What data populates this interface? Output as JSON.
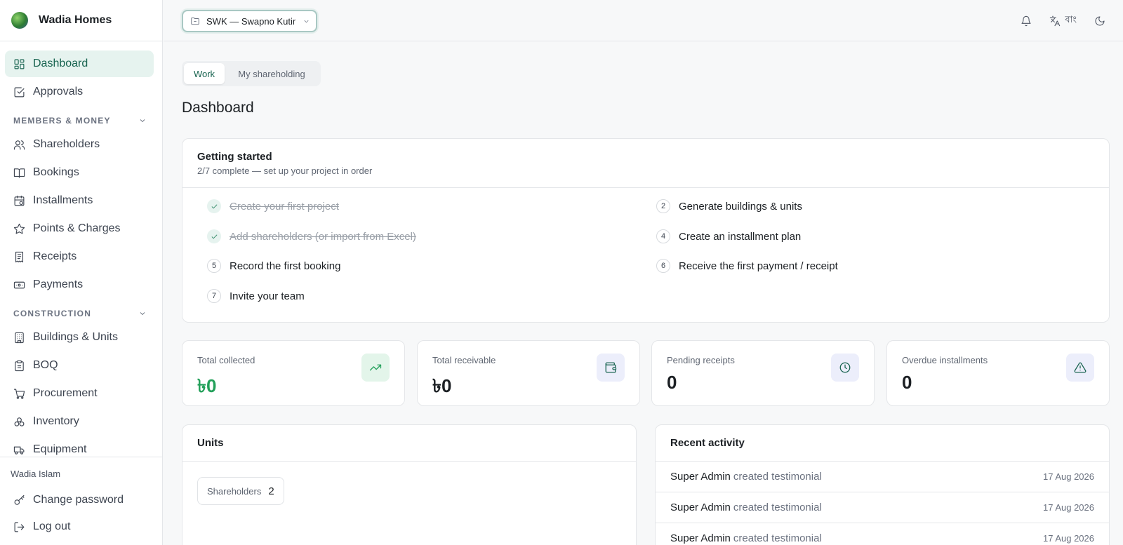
{
  "brand": {
    "name": "Wadia Homes"
  },
  "sidebar": {
    "top_items": [
      {
        "label": "Dashboard",
        "icon": "dashboard-icon",
        "active": true
      },
      {
        "label": "Approvals",
        "icon": "check-square-icon"
      }
    ],
    "sections": [
      {
        "label": "MEMBERS & MONEY",
        "items": [
          {
            "label": "Shareholders",
            "icon": "users-icon"
          },
          {
            "label": "Bookings",
            "icon": "book-icon"
          },
          {
            "label": "Installments",
            "icon": "calendar-clock-icon"
          },
          {
            "label": "Points & Charges",
            "icon": "star-icon"
          },
          {
            "label": "Receipts",
            "icon": "receipt-icon"
          },
          {
            "label": "Payments",
            "icon": "banknote-icon"
          }
        ]
      },
      {
        "label": "CONSTRUCTION",
        "items": [
          {
            "label": "Buildings & Units",
            "icon": "building-icon"
          },
          {
            "label": "BOQ",
            "icon": "clipboard-icon"
          },
          {
            "label": "Procurement",
            "icon": "cart-icon"
          },
          {
            "label": "Inventory",
            "icon": "boxes-icon"
          },
          {
            "label": "Equipment",
            "icon": "truck-icon"
          }
        ]
      }
    ],
    "footer": {
      "user": "Wadia Islam",
      "change_password": "Change password",
      "logout": "Log out"
    }
  },
  "topbar": {
    "project": "SWK — Swapno Kutir",
    "language": "বাং"
  },
  "tabs": [
    "Work",
    "My shareholding"
  ],
  "page_title": "Dashboard",
  "getting_started": {
    "title": "Getting started",
    "subtitle": "2/7 complete — set up your project in order",
    "steps": [
      {
        "num": "",
        "label": "Create your first project",
        "done": true
      },
      {
        "num": "2",
        "label": "Generate buildings & units",
        "done": false
      },
      {
        "num": "",
        "label": "Add shareholders (or import from Excel)",
        "done": true
      },
      {
        "num": "4",
        "label": "Create an installment plan",
        "done": false
      },
      {
        "num": "5",
        "label": "Record the first booking",
        "done": false
      },
      {
        "num": "6",
        "label": "Receive the first payment / receipt",
        "done": false
      },
      {
        "num": "7",
        "label": "Invite your team",
        "done": false
      }
    ]
  },
  "stats": [
    {
      "label": "Total collected",
      "value": "৳0",
      "icon": "trending-up-icon",
      "accent": "#23a05a"
    },
    {
      "label": "Total receivable",
      "value": "৳0",
      "icon": "wallet-icon",
      "accent": "#17634f"
    },
    {
      "label": "Pending receipts",
      "value": "0",
      "icon": "clock-icon",
      "accent": "#17634f"
    },
    {
      "label": "Overdue installments",
      "value": "0",
      "icon": "alert-triangle-icon",
      "accent": "#17634f"
    }
  ],
  "units": {
    "title": "Units",
    "chip_label": "Shareholders",
    "chip_value": "2"
  },
  "activity": {
    "title": "Recent activity",
    "rows": [
      {
        "who": "Super Admin",
        "what": "created testimonial",
        "date": "17 Aug 2026"
      },
      {
        "who": "Super Admin",
        "what": "created testimonial",
        "date": "17 Aug 2026"
      },
      {
        "who": "Super Admin",
        "what": "created testimonial",
        "date": "17 Aug 2026"
      }
    ]
  },
  "colors": {
    "accent": "#17634f",
    "accent_bg": "#e6f3ef",
    "positive": "#23a05a"
  }
}
